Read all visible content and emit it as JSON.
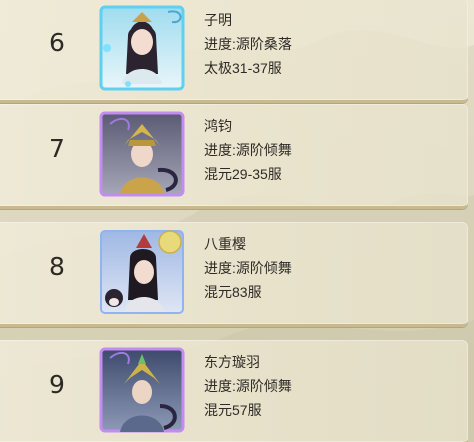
{
  "leaderboard": {
    "rows": [
      {
        "rank": "6",
        "name": "子明",
        "progress": "进度:源阶桑落",
        "server": "太极31-37服",
        "frame_color": "#5fd0f0"
      },
      {
        "rank": "7",
        "name": "鸿钧",
        "progress": "进度:源阶倾舞",
        "server": "混元29-35服",
        "frame_color": "#c28cf0"
      },
      {
        "rank": "8",
        "name": "八重樱",
        "progress": "进度:源阶倾舞",
        "server": "混元83服",
        "frame_color": "#8fb4f0"
      },
      {
        "rank": "9",
        "name": "东方璇羽",
        "progress": "进度:源阶倾舞",
        "server": "混元57服",
        "frame_color": "#c28cf0"
      }
    ]
  }
}
